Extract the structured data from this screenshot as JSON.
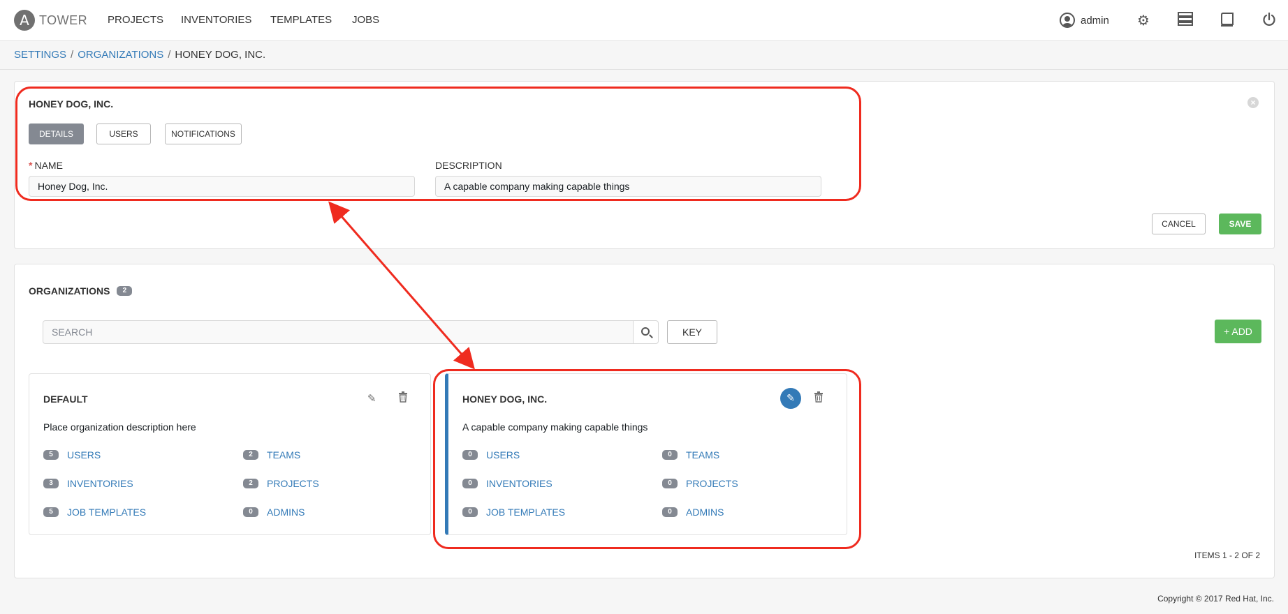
{
  "nav": {
    "logo_letter": "A",
    "brand": "TOWER",
    "links": [
      "PROJECTS",
      "INVENTORIES",
      "TEMPLATES",
      "JOBS"
    ],
    "user": "admin",
    "icons": [
      "user-icon",
      "gear-icon",
      "server-icon",
      "book-icon",
      "power-icon"
    ]
  },
  "breadcrumb": [
    "SETTINGS",
    "ORGANIZATIONS",
    "HONEY DOG, INC."
  ],
  "form": {
    "title": "HONEY DOG, INC.",
    "tabs": [
      "DETAILS",
      "USERS",
      "NOTIFICATIONS"
    ],
    "active_tab": "DETAILS",
    "name_label": "NAME",
    "name_required": "*",
    "name_value": "Honey Dog, Inc.",
    "description_label": "DESCRIPTION",
    "description_value": "A capable company making capable things",
    "cancel_label": "CANCEL",
    "save_label": "SAVE"
  },
  "list": {
    "title": "ORGANIZATIONS",
    "count": "2",
    "search_placeholder": "SEARCH",
    "key_label": "KEY",
    "add_label": "+ ADD",
    "items_label": "ITEMS  1 - 2 OF 2",
    "cards": [
      {
        "title": "DEFAULT",
        "description": "Place organization description here",
        "stats": [
          {
            "count": "5",
            "label": "USERS"
          },
          {
            "count": "2",
            "label": "TEAMS"
          },
          {
            "count": "3",
            "label": "INVENTORIES"
          },
          {
            "count": "2",
            "label": "PROJECTS"
          },
          {
            "count": "5",
            "label": "JOB TEMPLATES"
          },
          {
            "count": "0",
            "label": "ADMINS"
          }
        ]
      },
      {
        "title": "HONEY DOG, INC.",
        "description": "A capable company making capable things",
        "stats": [
          {
            "count": "0",
            "label": "USERS"
          },
          {
            "count": "0",
            "label": "TEAMS"
          },
          {
            "count": "0",
            "label": "INVENTORIES"
          },
          {
            "count": "0",
            "label": "PROJECTS"
          },
          {
            "count": "0",
            "label": "JOB TEMPLATES"
          },
          {
            "count": "0",
            "label": "ADMINS"
          }
        ]
      }
    ]
  },
  "footer": {
    "copyright": "Copyright © 2017 Red Hat, Inc."
  },
  "colors": {
    "accent": "#337ab7",
    "success": "#5cb85c",
    "annotation": "#ef2b1f",
    "badge": "#848992"
  }
}
